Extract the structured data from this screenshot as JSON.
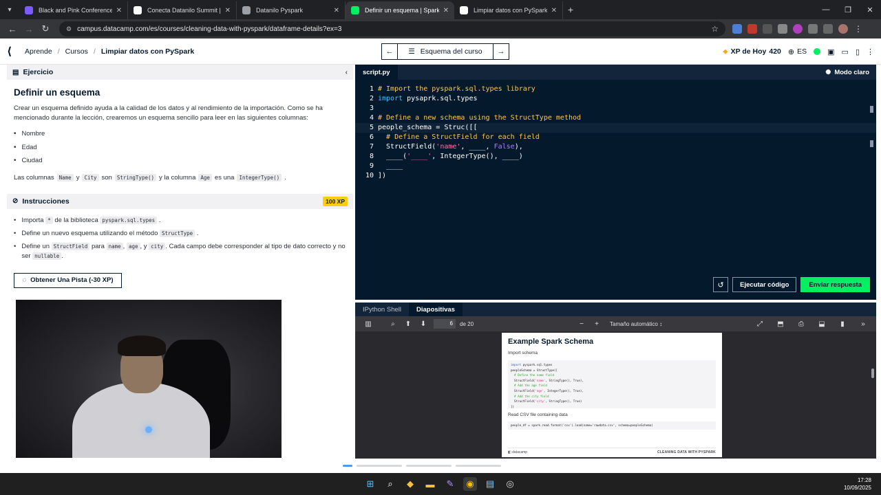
{
  "browser": {
    "tabs": [
      {
        "title": "Black and Pink Conference Eve",
        "icon": "canva-icon",
        "color": "#7d5cff",
        "active": false
      },
      {
        "title": "Conecta Datanilo Summit | UPC",
        "icon": "plus-icon",
        "color": "#ffffff",
        "active": false
      },
      {
        "title": "Datanilo Pyspark",
        "icon": "globe-icon",
        "color": "#9aa0a6",
        "active": false
      },
      {
        "title": "Definir un esquema | Spark",
        "icon": "datacamp-icon",
        "color": "#03ef62",
        "active": true
      },
      {
        "title": "Limpiar datos con PySpark",
        "icon": "notion-icon",
        "color": "#ffffff",
        "active": false
      }
    ],
    "url": "campus.datacamp.com/es/courses/cleaning-data-with-pyspark/dataframe-details?ex=3"
  },
  "header": {
    "breadcrumb": [
      "Aprende",
      "Cursos",
      "Limpiar datos con PySpark"
    ],
    "course_outline": "Esquema del curso",
    "xp_label": "XP de Hoy",
    "xp_value": "420",
    "lang": "ES"
  },
  "exercise": {
    "section_label": "Ejercicio",
    "title": "Definir un esquema",
    "intro": "Crear un esquema definido ayuda a la calidad de los datos y al rendimiento de la importación. Como se ha mencionado durante la lección, crearemos un esquema sencillo para leer en las siguientes columnas:",
    "columns": [
      "Nombre",
      "Edad",
      "Ciudad"
    ],
    "cols_line": {
      "t1": "Las columnas",
      "c1": "Name",
      "t2": "y",
      "c2": "City",
      "t3": "son",
      "c3": "StringType()",
      "t4": "y la columna",
      "c4": "Age",
      "t5": "es una",
      "c5": "IntegerType()",
      "t6": "."
    }
  },
  "instructions": {
    "label": "Instrucciones",
    "xp_badge": "100 XP",
    "items": [
      {
        "t1": "Importa",
        "c1": "*",
        "t2": "de la biblioteca",
        "c2": "pyspark.sql.types",
        "t3": "."
      },
      {
        "t1": "Define un nuevo esquema utilizando el método",
        "c1": "StructType",
        "t2": "."
      },
      {
        "t1": "Define un",
        "c1": "StructField",
        "t2": "para",
        "c2": "name",
        "t3": ",",
        "c3": "age",
        "t4": ", y",
        "c4": "city",
        "t5": ". Cada campo debe corresponder al tipo de dato correcto y no ser",
        "c5": "nullable",
        "t6": "."
      }
    ],
    "hint_button": "Obtener Una Pista (-30 XP)"
  },
  "editor": {
    "filename": "script.py",
    "light_mode": "Modo claro",
    "lines": [
      {
        "n": "1",
        "tokens": [
          [
            "cm",
            "# Import the pyspark.sql.types library"
          ]
        ]
      },
      {
        "n": "2",
        "tokens": [
          [
            "kw",
            "import"
          ],
          [
            "tx",
            " pysaprk.sql.types"
          ]
        ]
      },
      {
        "n": "3",
        "tokens": []
      },
      {
        "n": "4",
        "tokens": [
          [
            "cm",
            "# Define a new schema using the StructType method"
          ]
        ]
      },
      {
        "n": "5",
        "tokens": [
          [
            "tx",
            "people_schema = Struc([["
          ]
        ]
      },
      {
        "n": "6",
        "tokens": [
          [
            "tx",
            "  "
          ],
          [
            "cm",
            "# Define a StructField for each field"
          ]
        ]
      },
      {
        "n": "7",
        "tokens": [
          [
            "tx",
            "  StructField("
          ],
          [
            "st",
            "'name'"
          ],
          [
            "tx",
            ", ____, "
          ],
          [
            "fa",
            "False"
          ],
          [
            "tx",
            "),"
          ]
        ]
      },
      {
        "n": "8",
        "tokens": [
          [
            "tx",
            "  ____("
          ],
          [
            "st",
            "'____'"
          ],
          [
            "tx",
            ", IntegerType(), ____)"
          ]
        ]
      },
      {
        "n": "9",
        "tokens": [
          [
            "tx",
            "  ____"
          ]
        ]
      },
      {
        "n": "10",
        "tokens": [
          [
            "tx",
            "])"
          ]
        ]
      }
    ],
    "run_button": "Ejecutar código",
    "submit_button": "Enviar respuesta"
  },
  "bottom": {
    "tabs": [
      "IPython Shell",
      "Diapositivas"
    ],
    "active_tab": "Diapositivas",
    "pdf": {
      "page": "6",
      "of": "de 20",
      "zoom": "Tamaño automático"
    },
    "slide": {
      "title": "Example Spark Schema",
      "subtitle": "Import schema",
      "code": [
        [
          [
            "skw",
            "import"
          ],
          [
            "tx",
            " pyspark.sql.types"
          ]
        ],
        [
          [
            "tx",
            "peopleSchema = StructType(["
          ]
        ],
        [
          [
            "scm",
            "  # Define the name field"
          ]
        ],
        [
          [
            "tx",
            "  StructField("
          ],
          [
            "sst",
            "'name'"
          ],
          [
            "tx",
            ", StringType(), True),"
          ]
        ],
        [
          [
            "scm",
            "  # Add the age field"
          ]
        ],
        [
          [
            "tx",
            "  StructField("
          ],
          [
            "sst",
            "'age'"
          ],
          [
            "tx",
            ", IntegerType(), True),"
          ]
        ],
        [
          [
            "scm",
            "  # Add the city field"
          ]
        ],
        [
          [
            "tx",
            "  StructField("
          ],
          [
            "sst",
            "'city'"
          ],
          [
            "tx",
            ", StringType(), True)"
          ]
        ],
        [
          [
            "tx",
            "])"
          ]
        ]
      ],
      "subtitle2": "Read CSV file containing data",
      "code2": "people_df = spark.read.format('csv').load(name='rawdata.csv', schema=peopleSchema)",
      "footer_left": "datacamp",
      "footer_right": "CLEANING DATA WITH PYSPARK"
    }
  },
  "taskbar": {
    "time": "17:28",
    "date": "10/09/2025"
  }
}
